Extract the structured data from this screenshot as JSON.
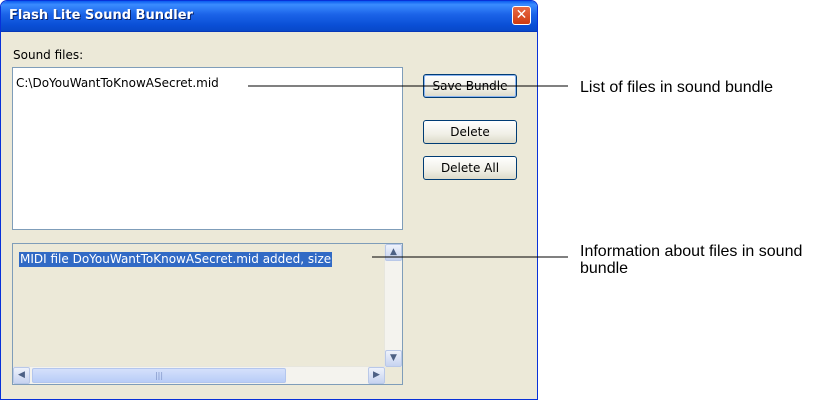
{
  "window": {
    "title": "Flash Lite Sound Bundler",
    "close_glyph": "✕"
  },
  "sound_files": {
    "label": "Sound files:",
    "items": [
      "C:\\DoYouWantToKnowASecret.mid"
    ]
  },
  "buttons": {
    "save_bundle": "Save Bundle",
    "delete": "Delete",
    "delete_all": "Delete All"
  },
  "info": {
    "text": "MIDI file DoYouWantToKnowASecret.mid added, size"
  },
  "scrollbars": {
    "up_arrow": "▲",
    "down_arrow": "▼",
    "left_arrow": "◀",
    "right_arrow": "▶",
    "thumb_grip": "|||"
  },
  "annotations": {
    "list_label": "List of files in sound bundle",
    "info_label": "Information about files in sound bundle"
  }
}
